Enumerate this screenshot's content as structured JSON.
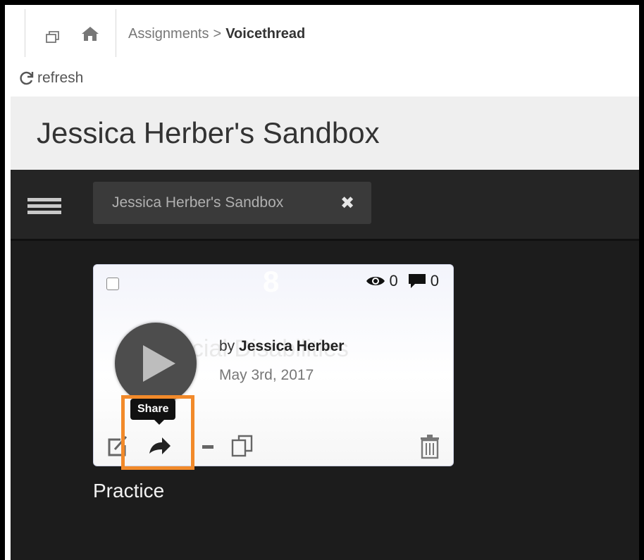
{
  "toolbar": {
    "breadcrumb_parent": "Assignments",
    "breadcrumb_separator": ">",
    "breadcrumb_current": "Voicethread",
    "refresh_label": "refresh",
    "icons": [
      "window-icon",
      "home-icon",
      "refresh-icon"
    ]
  },
  "page_title": "Jessica Herber's Sandbox",
  "nav": {
    "menu_icon": "hamburger-icon",
    "tab_label": "Jessica Herber's Sandbox",
    "tab_close": "✖"
  },
  "card": {
    "slide_number": "8",
    "views_count": "0",
    "comments_count": "0",
    "background_text": "ecial Disabilities",
    "author_prefix": "by",
    "author_name": "Jessica Herber",
    "date": "May 3rd, 2017",
    "tooltip": "Share",
    "title": "Practice",
    "icons": [
      "edit-icon",
      "share-icon",
      "minus-icon",
      "copy-icon",
      "trash-icon",
      "eye-icon",
      "comment-icon",
      "play-icon"
    ]
  },
  "colors": {
    "dark_background": "#1c1c1c",
    "highlight_orange": "#f28a2a",
    "title_bar": "#efefef"
  }
}
